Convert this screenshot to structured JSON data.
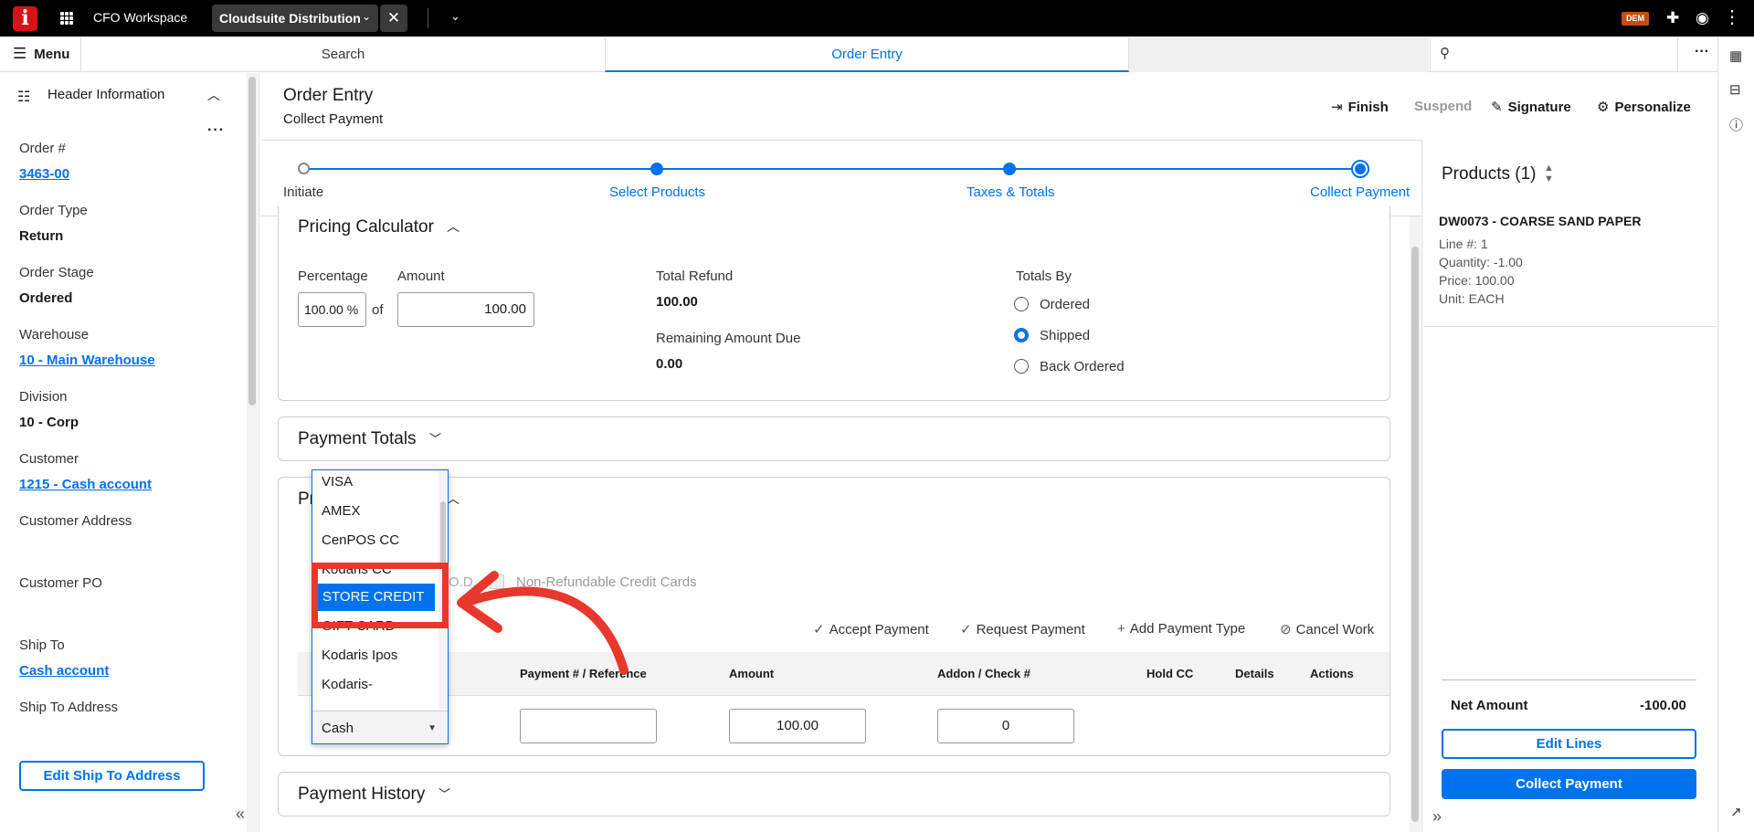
{
  "topbar": {
    "logo": "i",
    "workspace": "CFO Workspace",
    "app_tab": "Cloudsuite Distribution",
    "badge": "DEM"
  },
  "nav": {
    "menu_label": "Menu",
    "search_tab": "Search",
    "active_tab": "Order Entry",
    "search_placeholder": ""
  },
  "left_panel": {
    "title": "Header Information",
    "fields": {
      "order_num_label": "Order #",
      "order_num": "3463-00",
      "order_type_label": "Order Type",
      "order_type": "Return",
      "order_stage_label": "Order Stage",
      "order_stage": "Ordered",
      "warehouse_label": "Warehouse",
      "warehouse": "10 - Main Warehouse",
      "division_label": "Division",
      "division": "10 - Corp",
      "customer_label": "Customer",
      "customer": "1215 - Cash account",
      "customer_address_label": "Customer Address",
      "customer_po_label": "Customer PO",
      "ship_to_label": "Ship To",
      "ship_to": "Cash account",
      "ship_to_address_label": "Ship To Address"
    },
    "edit_ship_button": "Edit Ship To Address"
  },
  "page": {
    "title": "Order Entry",
    "subtitle": "Collect Payment",
    "actions": {
      "finish": "Finish",
      "suspend": "Suspend",
      "signature": "Signature",
      "personalize": "Personalize"
    }
  },
  "stepper": {
    "steps": [
      "Initiate",
      "Select Products",
      "Taxes & Totals",
      "Collect Payment"
    ]
  },
  "pricing": {
    "title": "Pricing Calculator",
    "percentage_label": "Percentage",
    "percentage_value": "100.00 %",
    "of_label": "of",
    "amount_label": "Amount",
    "amount_value": "100.00",
    "total_refund_label": "Total Refund",
    "total_refund": "100.00",
    "remaining_label": "Remaining Amount Due",
    "remaining": "0.00",
    "totals_by_label": "Totals By",
    "options": [
      "Ordered",
      "Shipped",
      "Back Ordered"
    ],
    "selected_option": "Shipped"
  },
  "payment_totals": {
    "title": "Payment Totals"
  },
  "payments": {
    "title_partial": "Pr",
    "cod_partial": "O.D.",
    "non_refundable_label": "Non-Refundable Credit Cards",
    "toolbar": {
      "accept": "Accept Payment",
      "request": "Request Payment",
      "add_type": "Add Payment Type",
      "cancel": "Cancel Work"
    },
    "columns": [
      "Payment # / Reference",
      "Amount",
      "Addon / Check #",
      "Hold CC",
      "Details",
      "Actions"
    ],
    "row": {
      "payment_type": "Cash",
      "reference": "",
      "amount": "100.00",
      "addon": "0"
    }
  },
  "dropdown": {
    "options": [
      "VISA",
      "AMEX",
      "CenPOS CC",
      "Kodaris CC",
      "STORE CREDIT",
      "GIFT CARD",
      "Kodaris Ipos",
      "Kodaris-"
    ],
    "highlighted": "STORE CREDIT"
  },
  "payment_history": {
    "title": "Payment History"
  },
  "products": {
    "title": "Products (1)",
    "item_name": "DW0073 - COARSE SAND PAPER",
    "line": "Line #: 1",
    "quantity": "Quantity: -1.00",
    "price": "Price: 100.00",
    "unit": "Unit: EACH",
    "net_label": "Net Amount",
    "net_value": "-100.00",
    "edit_lines": "Edit Lines",
    "collect_payment": "Collect Payment"
  },
  "colors": {
    "accent": "#0072ed",
    "brand": "#da1217",
    "annotation": "#e8372c"
  }
}
